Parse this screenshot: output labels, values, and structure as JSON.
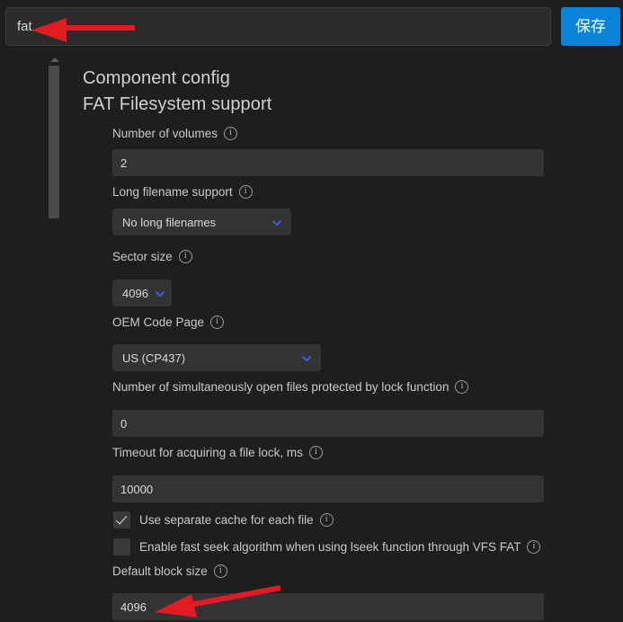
{
  "topbar": {
    "search_value": "fat",
    "search_placeholder": "",
    "save_label": "保存"
  },
  "headings": {
    "component_config": "Component config",
    "section_title": "FAT Filesystem support"
  },
  "fields": [
    {
      "id": "number-of-volumes",
      "label": "Number of volumes",
      "type": "text",
      "value": "2"
    },
    {
      "id": "long-filename-support",
      "label": "Long filename support",
      "type": "select",
      "value": "No long filenames"
    },
    {
      "id": "sector-size",
      "label": "Sector size",
      "type": "select",
      "value": "4096"
    },
    {
      "id": "oem-code-page",
      "label": "OEM Code Page",
      "type": "select",
      "value": "US (CP437)"
    },
    {
      "id": "open-files-lock",
      "label": "Number of simultaneously open files protected by lock function",
      "type": "text",
      "value": "0"
    },
    {
      "id": "file-lock-timeout",
      "label": "Timeout for acquiring a file lock, ms",
      "type": "text",
      "value": "10000"
    },
    {
      "id": "separate-cache",
      "label": "Use separate cache for each file",
      "type": "checkbox",
      "checked": true
    },
    {
      "id": "fast-seek",
      "label": "Enable fast seek algorithm when using lseek function through VFS FAT",
      "type": "checkbox",
      "checked": false
    },
    {
      "id": "default-block-size",
      "label": "Default block size",
      "type": "text",
      "value": "4096"
    }
  ],
  "colors": {
    "background": "#1e1e1e",
    "field_background": "#333333",
    "accent_button": "#0a84d8",
    "chevron": "#3d5afe",
    "annotation_arrow": "#e01b21"
  },
  "annotations": [
    {
      "id": "arrow-search",
      "points_to": "search-input"
    },
    {
      "id": "arrow-default-block-size",
      "points_to": "default-block-size-field"
    }
  ],
  "scrollbar": {
    "up_arrow_icon": "triangle-up-icon"
  }
}
